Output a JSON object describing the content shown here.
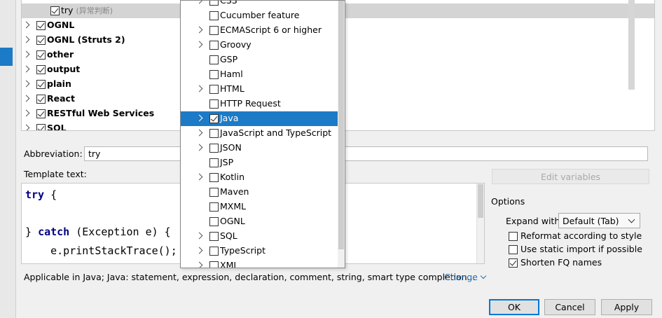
{
  "tree": {
    "rows": [
      {
        "label": "try",
        "suffix": "(异常判断)",
        "checked": true,
        "expandable": false,
        "child": true,
        "selected": true
      },
      {
        "label": "OGNL",
        "checked": true,
        "expandable": true
      },
      {
        "label": "OGNL (Struts 2)",
        "checked": true,
        "expandable": true
      },
      {
        "label": "other",
        "checked": true,
        "expandable": true
      },
      {
        "label": "output",
        "checked": true,
        "expandable": true
      },
      {
        "label": "plain",
        "checked": true,
        "expandable": true
      },
      {
        "label": "React",
        "checked": true,
        "expandable": true
      },
      {
        "label": "RESTful Web Services",
        "checked": true,
        "expandable": true
      },
      {
        "label": "SQL",
        "checked": true,
        "expandable": true
      }
    ]
  },
  "abbreviation": {
    "label": "Abbreviation:",
    "value": "try"
  },
  "template_text": {
    "label": "Template text:",
    "lines": [
      "try {",
      "",
      "} catch (Exception e) {",
      "    e.printStackTrace();"
    ]
  },
  "edit_variables_label": "Edit variables",
  "options": {
    "title": "Options",
    "expand_with_label": "Expand with",
    "expand_with_value": "Default (Tab)",
    "checkboxes": [
      {
        "label": "Reformat according to style",
        "checked": false
      },
      {
        "label": "Use static import if possible",
        "checked": false
      },
      {
        "label": "Shorten FQ names",
        "checked": true
      }
    ]
  },
  "applicable_text": "Applicable in Java; Java: statement, expression, declaration, comment, string, smart type completion...",
  "change_label": "Change",
  "buttons": {
    "ok": "OK",
    "cancel": "Cancel",
    "apply": "Apply"
  },
  "context_popup": {
    "items": [
      {
        "label": "CSS",
        "expandable": true,
        "checked": false
      },
      {
        "label": "Cucumber feature",
        "expandable": false,
        "checked": false
      },
      {
        "label": "ECMAScript 6 or higher",
        "expandable": true,
        "checked": false
      },
      {
        "label": "Groovy",
        "expandable": true,
        "checked": false
      },
      {
        "label": "GSP",
        "expandable": false,
        "checked": false
      },
      {
        "label": "Haml",
        "expandable": false,
        "checked": false
      },
      {
        "label": "HTML",
        "expandable": true,
        "checked": false
      },
      {
        "label": "HTTP Request",
        "expandable": false,
        "checked": false
      },
      {
        "label": "Java",
        "expandable": true,
        "checked": true,
        "selected": true
      },
      {
        "label": "JavaScript and TypeScript",
        "expandable": true,
        "checked": false
      },
      {
        "label": "JSON",
        "expandable": true,
        "checked": false
      },
      {
        "label": "JSP",
        "expandable": false,
        "checked": false
      },
      {
        "label": "Kotlin",
        "expandable": true,
        "checked": false
      },
      {
        "label": "Maven",
        "expandable": false,
        "checked": false
      },
      {
        "label": "MXML",
        "expandable": false,
        "checked": false
      },
      {
        "label": "OGNL",
        "expandable": false,
        "checked": false
      },
      {
        "label": "SQL",
        "expandable": true,
        "checked": false
      },
      {
        "label": "TypeScript",
        "expandable": true,
        "checked": false
      },
      {
        "label": "XML",
        "expandable": true,
        "checked": false
      }
    ]
  },
  "colors": {
    "selection": "#1c7ac6",
    "link": "#2470b3",
    "keyword": "#000080"
  }
}
